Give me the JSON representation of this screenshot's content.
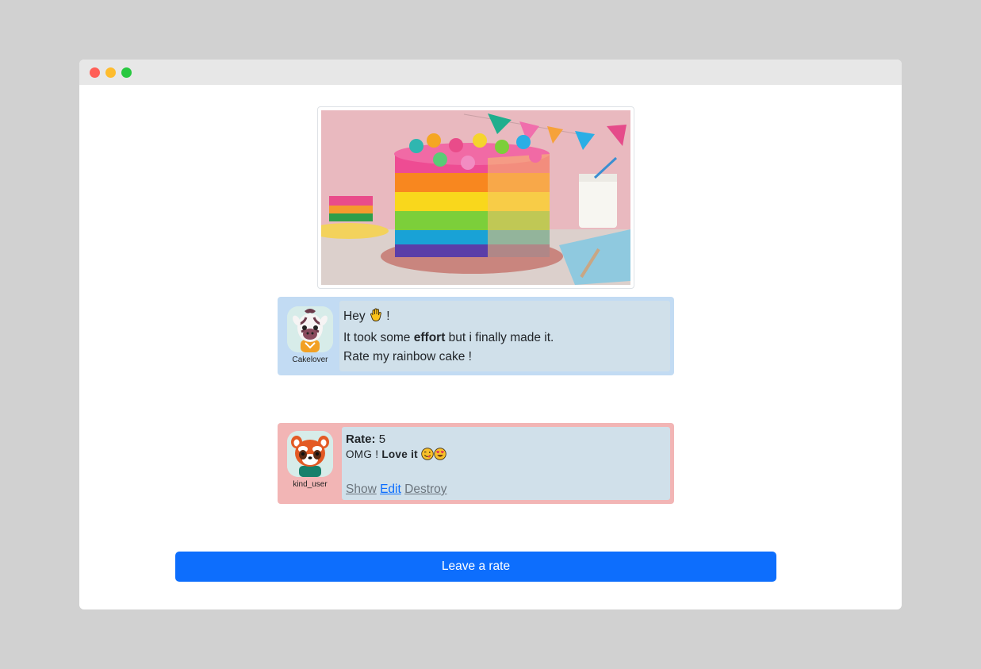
{
  "post": {
    "author": "Cakelover",
    "greeting": "Hey",
    "greeting_end": "!",
    "line2_pre": "It took some",
    "line2_bold": "effort",
    "line2_post": "but i finally made it.",
    "line3": "Rate my rainbow cake !",
    "image_icon": "rainbow-cake-photo"
  },
  "rate": {
    "author": "kind_user",
    "rate_label": "Rate:",
    "rate_value": "5",
    "comment_pre": "OMG !",
    "comment_bold": "Love it",
    "links": {
      "show": "Show",
      "edit": "Edit",
      "destroy": "Destroy"
    }
  },
  "cta": {
    "label": "Leave a rate"
  },
  "colors": {
    "post_card": "#c2dbf3",
    "rate_card": "#f2b5b5",
    "bubble": "#d0e0ea",
    "primary": "#0d6efd"
  }
}
